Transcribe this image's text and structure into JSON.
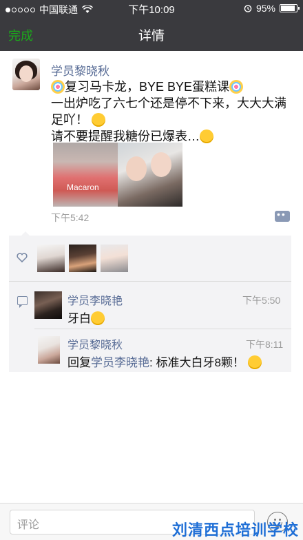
{
  "status_bar": {
    "carrier": "中国联通",
    "time": "下午10:09",
    "battery_percent": "95%",
    "battery_level": 0.95,
    "signal_bars_filled": 1
  },
  "nav": {
    "done_label": "完成",
    "title": "详情"
  },
  "post": {
    "author": "学员黎晓秋",
    "line1": "复习马卡龙，BYE BYE蛋糕课",
    "line2": "一出炉吃了六七个还是停不下来，大大大满",
    "line3": "足吖！",
    "line4": "请不要提醒我糖份已爆表…",
    "photo1_caption": "Macaron",
    "time": "下午5:42"
  },
  "comments": [
    {
      "author": "学员李晓艳",
      "time": "下午5:50",
      "text": "牙白"
    },
    {
      "author": "学员黎晓秋",
      "time": "下午8:11",
      "reply_prefix": "回复",
      "reply_to": "学员李晓艳",
      "text": ": 标准大白牙8颗！"
    }
  ],
  "bottom": {
    "placeholder": "评论",
    "watermark": "刘清西点培训学校"
  },
  "colors": {
    "accent_green": "#1aad19",
    "link_blue": "#576b95"
  }
}
